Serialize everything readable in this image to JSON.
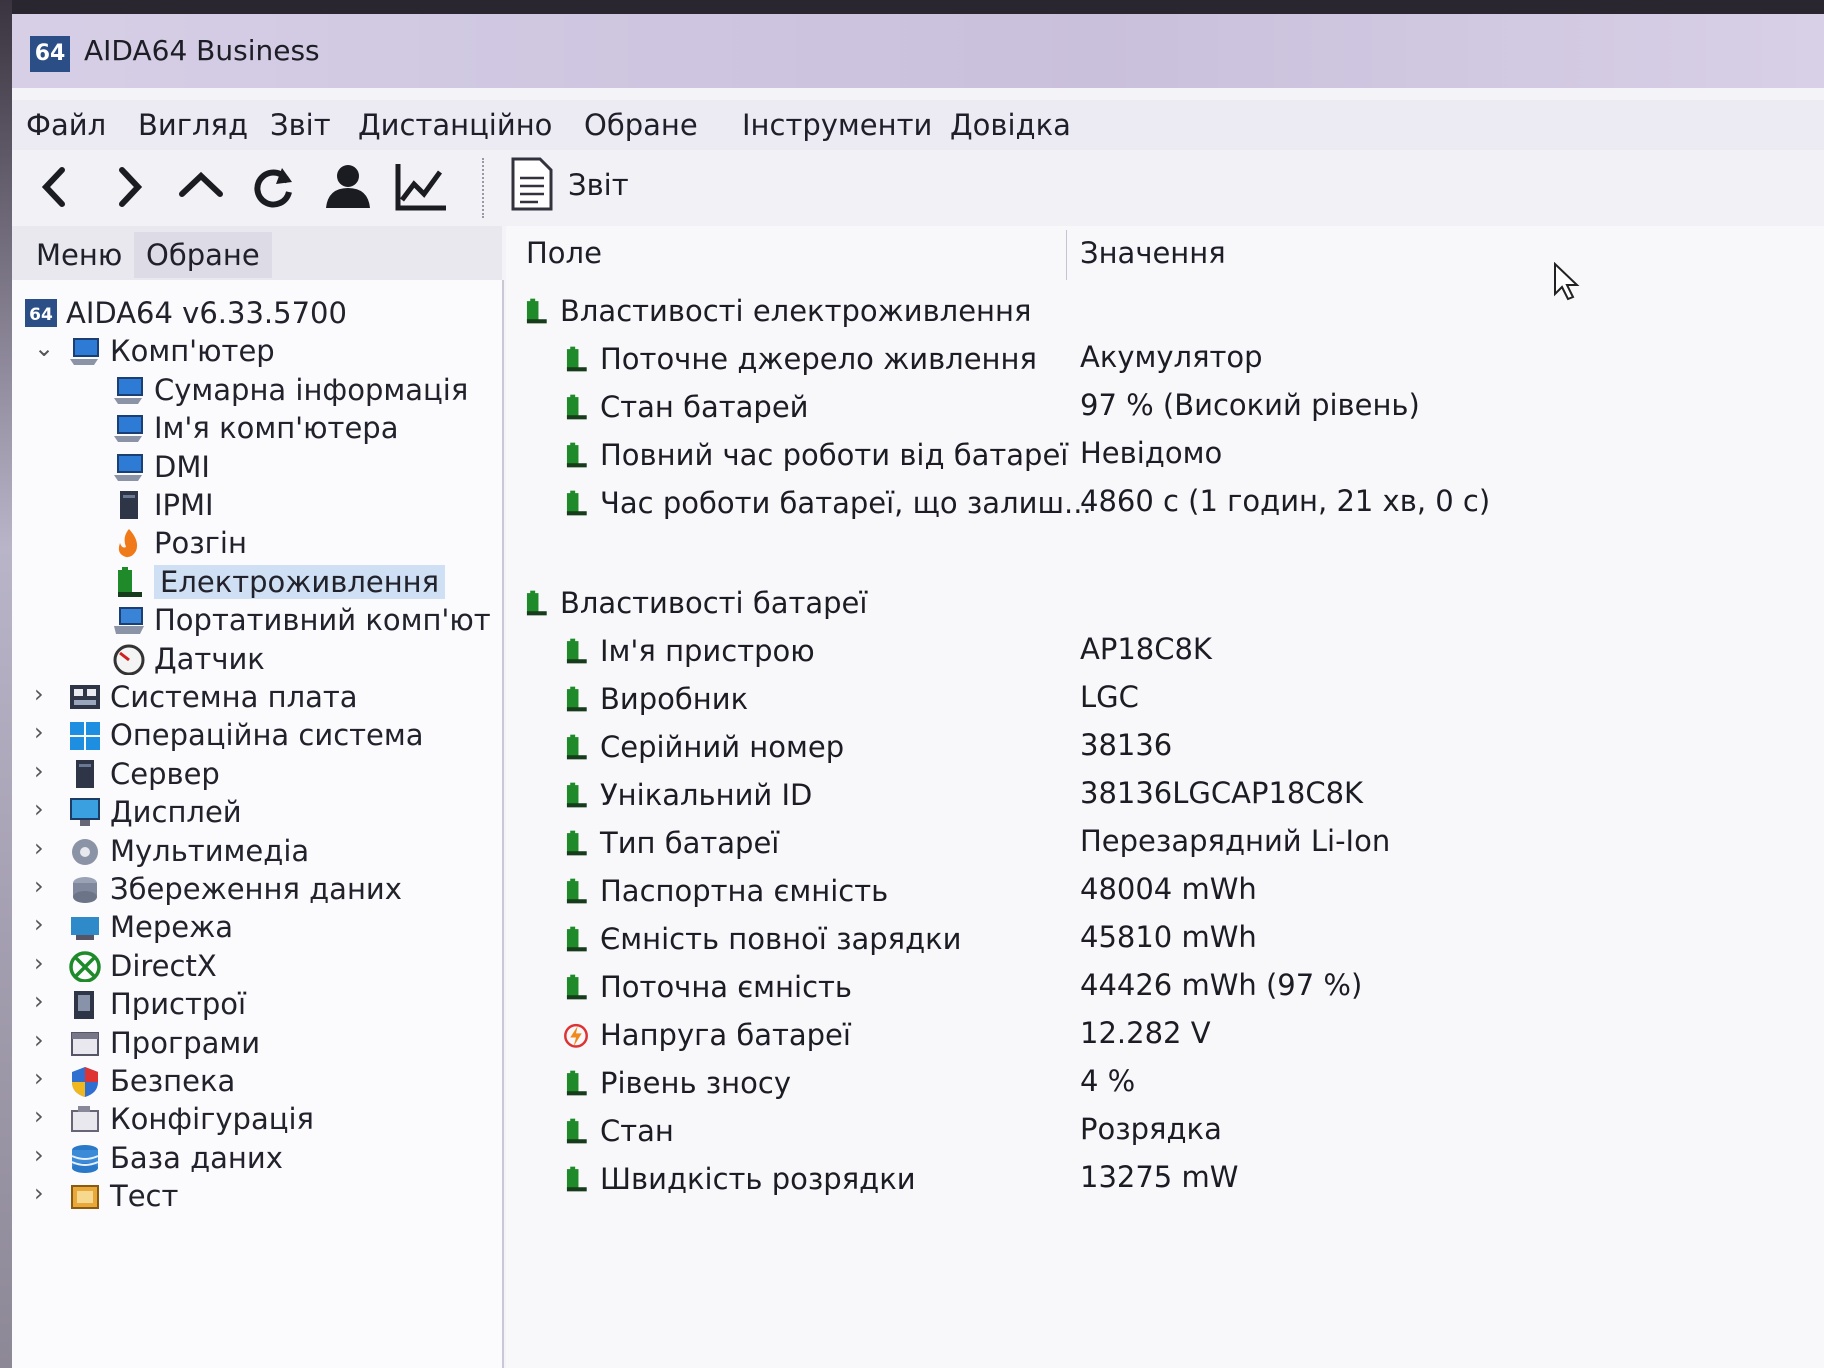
{
  "window": {
    "title": "AIDA64 Business",
    "logo_text": "64"
  },
  "menu": [
    "Файл",
    "Вигляд",
    "Звіт",
    "Дистанційно",
    "Обране",
    "Інструменти",
    "Довідка"
  ],
  "toolbar": {
    "icons": [
      "back-icon",
      "forward-icon",
      "up-icon",
      "refresh-icon",
      "user-icon",
      "chart-icon"
    ],
    "report_label": "Звіт"
  },
  "left_tabs": [
    "Меню",
    "Обране"
  ],
  "tree": [
    {
      "label": "AIDA64 v6.33.5700",
      "icon": "aida-logo-icon",
      "level": 0,
      "expander": ""
    },
    {
      "label": "Комп'ютер",
      "icon": "computer-icon",
      "level": 1,
      "expander": "v"
    },
    {
      "label": "Сумарна інформація",
      "icon": "computer-icon",
      "level": 2,
      "expander": ""
    },
    {
      "label": "Ім'я комп'ютера",
      "icon": "computer-icon",
      "level": 2,
      "expander": ""
    },
    {
      "label": "DMI",
      "icon": "computer-icon",
      "level": 2,
      "expander": ""
    },
    {
      "label": "IPMI",
      "icon": "server-icon",
      "level": 2,
      "expander": ""
    },
    {
      "label": "Розгін",
      "icon": "flame-icon",
      "level": 2,
      "expander": ""
    },
    {
      "label": "Електроживлення",
      "icon": "battery-icon",
      "level": 2,
      "expander": "",
      "selected": true
    },
    {
      "label": "Портативний комп'ют",
      "icon": "laptop-icon",
      "level": 2,
      "expander": ""
    },
    {
      "label": "Датчик",
      "icon": "gauge-icon",
      "level": 2,
      "expander": ""
    },
    {
      "label": "Системна плата",
      "icon": "motherboard-icon",
      "level": 1,
      "expander": ">"
    },
    {
      "label": "Операційна система",
      "icon": "windows-icon",
      "level": 1,
      "expander": ">"
    },
    {
      "label": "Сервер",
      "icon": "server-icon",
      "level": 1,
      "expander": ">"
    },
    {
      "label": "Дисплей",
      "icon": "display-icon",
      "level": 1,
      "expander": ">"
    },
    {
      "label": "Мультимедіа",
      "icon": "multimedia-icon",
      "level": 1,
      "expander": ">"
    },
    {
      "label": "Збереження даних",
      "icon": "storage-icon",
      "level": 1,
      "expander": ">"
    },
    {
      "label": "Мережа",
      "icon": "network-icon",
      "level": 1,
      "expander": ">"
    },
    {
      "label": "DirectX",
      "icon": "xbox-icon",
      "level": 1,
      "expander": ">"
    },
    {
      "label": "Пристрої",
      "icon": "devices-icon",
      "level": 1,
      "expander": ">"
    },
    {
      "label": "Програми",
      "icon": "programs-icon",
      "level": 1,
      "expander": ">"
    },
    {
      "label": "Безпека",
      "icon": "shield-icon",
      "level": 1,
      "expander": ">"
    },
    {
      "label": "Конфігурація",
      "icon": "config-icon",
      "level": 1,
      "expander": ">"
    },
    {
      "label": "База даних",
      "icon": "database-icon",
      "level": 1,
      "expander": ">"
    },
    {
      "label": "Тест",
      "icon": "benchmark-icon",
      "level": 1,
      "expander": ">"
    }
  ],
  "columns": {
    "field": "Поле",
    "value": "Значення"
  },
  "groups": [
    {
      "title": "Властивості електроживлення",
      "rows": [
        {
          "field": "Поточне джерело живлення",
          "value": "Акумулятор"
        },
        {
          "field": "Стан батарей",
          "value": "97 % (Високий рівень)"
        },
        {
          "field": "Повний час роботи від батареї",
          "value": "Невідомо"
        },
        {
          "field": "Час роботи батареї, що залиш...",
          "value": "4860 с (1 годин, 21 хв, 0 с)"
        }
      ]
    },
    {
      "title": "Властивості батареї",
      "rows": [
        {
          "field": "Ім'я пристрою",
          "value": "AP18C8K"
        },
        {
          "field": "Виробник",
          "value": "LGC"
        },
        {
          "field": "Серійний номер",
          "value": "38136"
        },
        {
          "field": "Унікальний ID",
          "value": "38136LGCAP18C8K"
        },
        {
          "field": "Тип батареї",
          "value": "Перезарядний Li-Ion"
        },
        {
          "field": "Паспортна ємність",
          "value": "48004 mWh"
        },
        {
          "field": "Ємність повної зарядки",
          "value": "45810 mWh"
        },
        {
          "field": "Поточна ємність",
          "value": "44426 mWh  (97 %)"
        },
        {
          "field": "Напруга батареї",
          "value": "12.282 V",
          "icon": "voltage-icon"
        },
        {
          "field": "Рівень зносу",
          "value": "4 %"
        },
        {
          "field": "Стан",
          "value": "Розрядка"
        },
        {
          "field": "Швидкість розрядки",
          "value": "13275 mW"
        }
      ]
    }
  ],
  "colors": {
    "accent_green": "#1f8a2a",
    "selection": "#cfe0f4",
    "logo_blue": "#2c4e86"
  }
}
